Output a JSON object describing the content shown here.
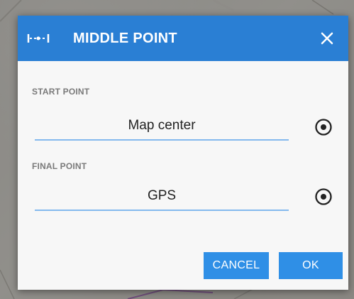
{
  "dialog": {
    "title": "MIDDLE POINT",
    "header_icon": "middle-point-icon",
    "close_icon": "close-icon",
    "header_color": "#2a7fd4"
  },
  "start_point": {
    "label": "START POINT",
    "value": "Map center",
    "select_icon": "target-icon"
  },
  "final_point": {
    "label": "FINAL POINT",
    "value": "GPS",
    "select_icon": "target-icon"
  },
  "buttons": {
    "cancel_label": "CANCEL",
    "ok_label": "OK",
    "button_color": "#2f8fe6"
  }
}
